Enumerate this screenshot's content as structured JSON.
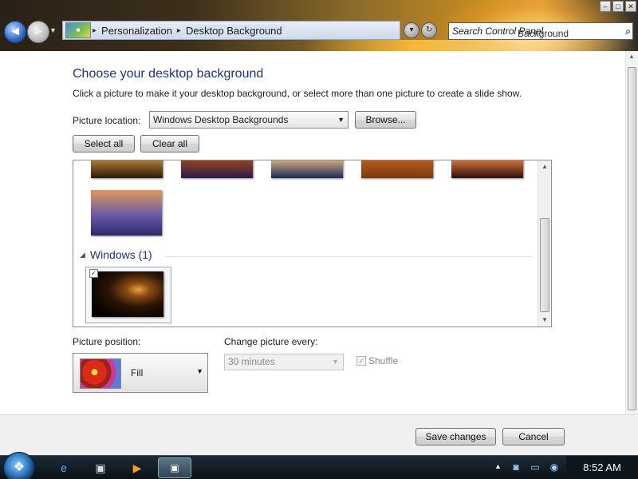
{
  "window": {
    "minimize": "0",
    "maximize": "1",
    "close": "r",
    "back_icon": "arrow-left-icon",
    "forward_icon": "arrow-right-icon"
  },
  "address": {
    "crumbs": [
      "Personalization",
      "Desktop Background"
    ],
    "search_placeholder": "Search Control Panel",
    "search_ghost": "Background",
    "back_glyph": "◄",
    "fwd_glyph": "►",
    "drop_glyph": "▼",
    "sep_glyph": "▸"
  },
  "heading": "Choose your desktop background",
  "subtitle": "Click a picture to make it your desktop background, or select more than one picture to create a slide show.",
  "location": {
    "label": "Picture location:",
    "value": "Windows Desktop Backgrounds",
    "browse": "Browse..."
  },
  "buttons": {
    "select_all": "Select all",
    "clear_all": "Clear all",
    "save": "Save changes",
    "cancel": "Cancel"
  },
  "gallery": {
    "group_name": "Windows (1)",
    "thumbnails": [
      {
        "theme": "sunset-field",
        "colors": [
          "#7a4a1c",
          "#c58a3a",
          "#2b1a0d"
        ]
      },
      {
        "theme": "canyon",
        "colors": [
          "#e09a3a",
          "#a84a12",
          "#2b1a50"
        ]
      },
      {
        "theme": "hot-air-balloon",
        "colors": [
          "#8bb0e0",
          "#f0c080",
          "#1a2a5a"
        ]
      },
      {
        "theme": "desert-balloon",
        "colors": [
          "#f0b040",
          "#c06020",
          "#7a3a10"
        ]
      },
      {
        "theme": "red-rocks",
        "colors": [
          "#c03030",
          "#f08040",
          "#301010"
        ]
      },
      {
        "theme": "lupine-lake",
        "colors": [
          "#e09858",
          "#6a5aa8",
          "#2a2a6a"
        ]
      }
    ],
    "selected_check": "✓"
  },
  "position": {
    "label": "Picture position:",
    "value": "Fill"
  },
  "interval": {
    "label": "Change picture every:",
    "value": "30 minutes"
  },
  "shuffle": {
    "label": "Shuffle",
    "checked": true
  },
  "taskbar": {
    "time": "8:52 AM",
    "start_icon": "windows-orb-icon"
  }
}
